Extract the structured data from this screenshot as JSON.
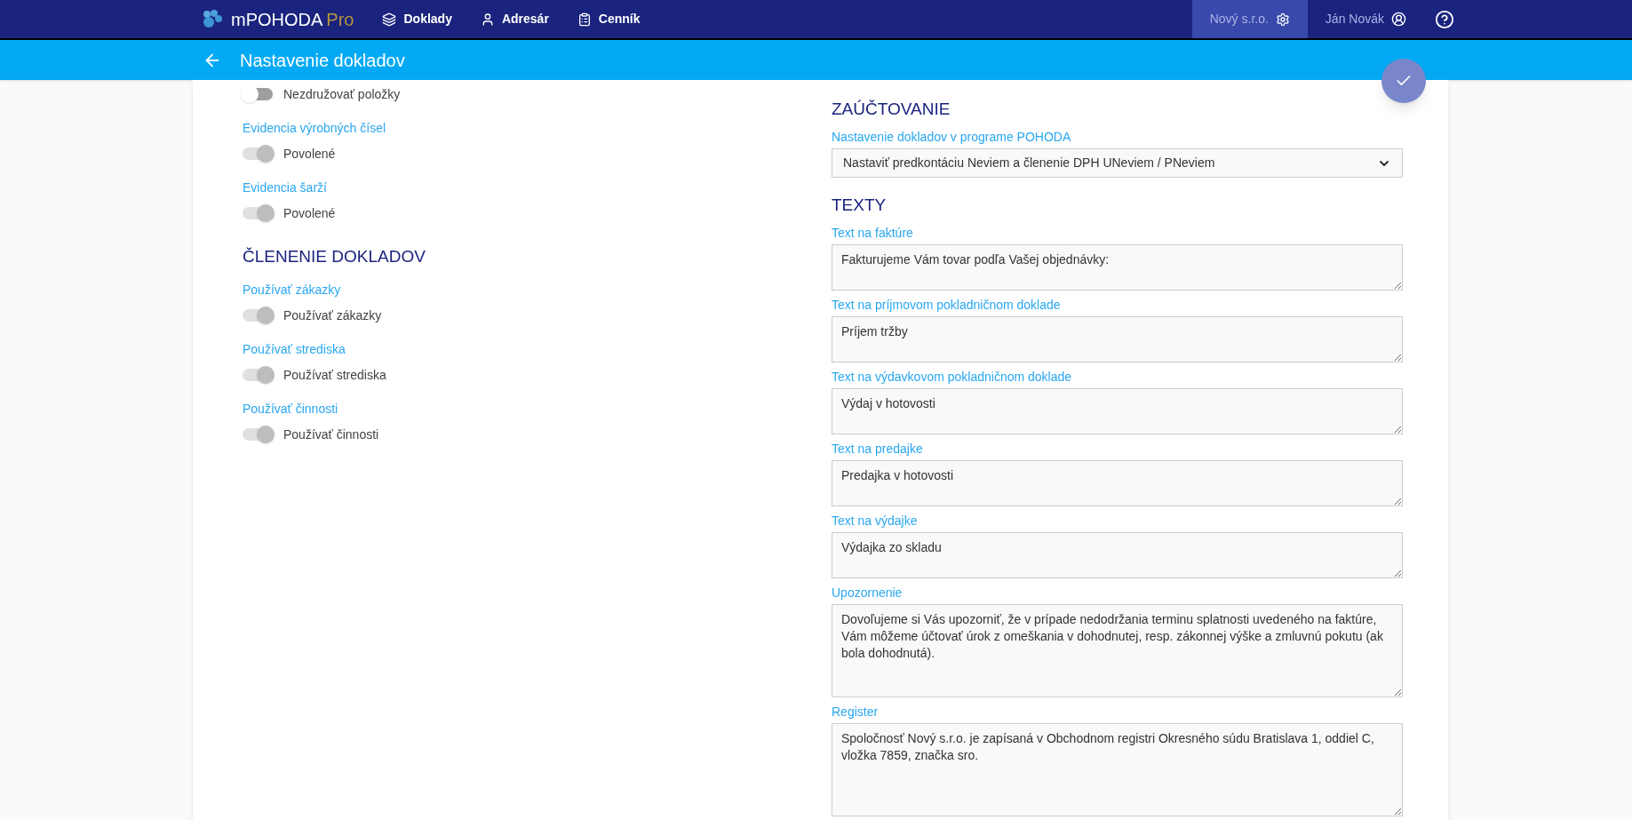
{
  "app": {
    "brand": "mPOHODA",
    "brand_suffix": "Pro"
  },
  "nav": [
    {
      "label": "Doklady"
    },
    {
      "label": "Adresár"
    },
    {
      "label": "Cenník"
    }
  ],
  "company": {
    "label": "Nový s.r.o.",
    "selected": true
  },
  "user": "Ján Novák",
  "page_title": "Nastavenie dokladov",
  "left": [
    {
      "kind": "toggle",
      "text": "Nezdružovať položky",
      "on": false,
      "disabled": false
    },
    {
      "kind": "label",
      "text": "Evidencia výrobných čísel"
    },
    {
      "kind": "toggle",
      "text": "Povolené",
      "on": true,
      "disabled": true
    },
    {
      "kind": "label",
      "text": "Evidencia šarží"
    },
    {
      "kind": "toggle",
      "text": "Povolené",
      "on": true,
      "disabled": true
    },
    {
      "kind": "heading",
      "text": "ČLENENIE DOKLADOV"
    },
    {
      "kind": "label",
      "text": "Používať zákazky"
    },
    {
      "kind": "toggle",
      "text": "Používať zákazky",
      "on": true,
      "disabled": true
    },
    {
      "kind": "label",
      "text": "Používať strediska"
    },
    {
      "kind": "toggle",
      "text": "Používať strediska",
      "on": true,
      "disabled": true
    },
    {
      "kind": "label",
      "text": "Používať činnosti"
    },
    {
      "kind": "toggle",
      "text": "Používať činnosti",
      "on": true,
      "disabled": true
    }
  ],
  "right": [
    {
      "kind": "heading",
      "text": "ZAÚČTOVANIE"
    },
    {
      "kind": "label",
      "text": "Nastavenie dokladov v programe POHODA"
    },
    {
      "kind": "select",
      "value": "Nastaviť predkontáciu Neviem a členenie DPH UNeviem / PNeviem"
    },
    {
      "kind": "heading",
      "text": "TEXTY"
    },
    {
      "kind": "label",
      "text": "Text na faktúre"
    },
    {
      "kind": "textarea",
      "value": "Fakturujeme Vám tovar podľa Vašej objednávky:"
    },
    {
      "kind": "label",
      "text": "Text na príjmovom pokladničnom doklade"
    },
    {
      "kind": "textarea",
      "value": "Príjem tržby"
    },
    {
      "kind": "label",
      "text": "Text na výdavkovom pokladničnom doklade"
    },
    {
      "kind": "textarea",
      "value": "Výdaj v hotovosti"
    },
    {
      "kind": "label",
      "text": "Text na predajke"
    },
    {
      "kind": "textarea",
      "value": "Predajka v hotovosti"
    },
    {
      "kind": "label",
      "text": "Text na výdajke"
    },
    {
      "kind": "textarea",
      "value": "Výdajka zo skladu"
    },
    {
      "kind": "label",
      "text": "Upozornenie"
    },
    {
      "kind": "long_textarea",
      "value": "Dovoľujeme si Vás upozorniť, že v prípade nedodržania terminu splatnosti uvedeného na faktúre, Vám môžeme účtovať úrok z omeškania v dohodnutej, resp. zákonnej výške a zmluvnú pokutu (ak bola dohodnutá)."
    },
    {
      "kind": "label",
      "text": "Register"
    },
    {
      "kind": "long_textarea",
      "value": "Spoločnosť Nový s.r.o. je zapísaná v Obchodnom registri Okresného súdu Bratislava 1, oddiel C, vložka 7859, značka sro."
    }
  ]
}
